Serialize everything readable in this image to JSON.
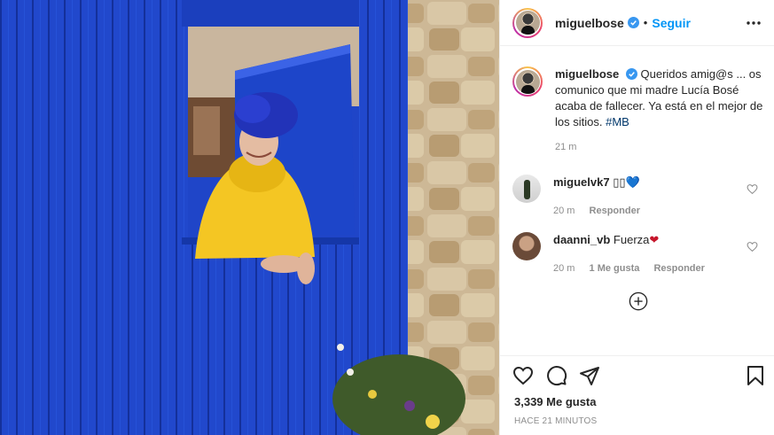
{
  "post": {
    "author": "miguelbose",
    "follow_label": "Seguir",
    "separator": "•",
    "caption_text": "Queridos amig@s ... os comunico que mi madre Lucía Bosé acaba de fallecer. Ya está en el mejor de los sitios.",
    "caption_hashtag": "#MB",
    "caption_time": "21 m",
    "likes": "3,339 Me gusta",
    "posted_ago": "HACE 21 MINUTOS"
  },
  "comments": [
    {
      "user": "miguelvk7",
      "text": "▯▯",
      "emoji": "💙",
      "time": "20 m",
      "likes_label": "",
      "reply_label": "Responder"
    },
    {
      "user": "daanni_vb",
      "text": "Fuerza",
      "emoji": "❤",
      "time": "20 m",
      "likes_label": "1 Me gusta",
      "reply_label": "Responder"
    }
  ],
  "icons": {
    "verified": "verified-badge-icon",
    "more": "more-options-icon",
    "like": "heart-icon",
    "comment": "comment-icon",
    "share": "share-icon",
    "save": "bookmark-icon",
    "load_more": "plus-circle-icon"
  },
  "colors": {
    "accent": "#0095f6",
    "verified": "#3897f0",
    "hashtag": "#00376b",
    "muted": "#8e8e8e",
    "door_blue": "#1f45c8",
    "sweater_yellow": "#f4c623",
    "heart_red": "#c6162b",
    "heart_blue": "#1fb6d6"
  }
}
